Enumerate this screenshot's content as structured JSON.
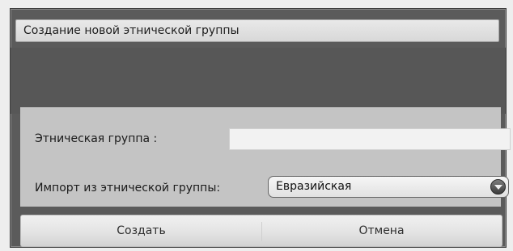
{
  "dialog": {
    "title": "Создание новой этнической группы"
  },
  "form": {
    "ethnic_group_label": "Этническая группа :",
    "ethnic_group_value": "",
    "import_label": "Импорт из этнической группы:",
    "import_selected": "Евразийская"
  },
  "buttons": {
    "create_label": "Создать",
    "cancel_label": "Отмена"
  },
  "icons": {
    "dropdown": "chevron-down-icon"
  },
  "colors": {
    "dialog_background": "#5b5b5b",
    "panel_background": "#c4c4c4",
    "button_background": "#e2e2e2"
  }
}
